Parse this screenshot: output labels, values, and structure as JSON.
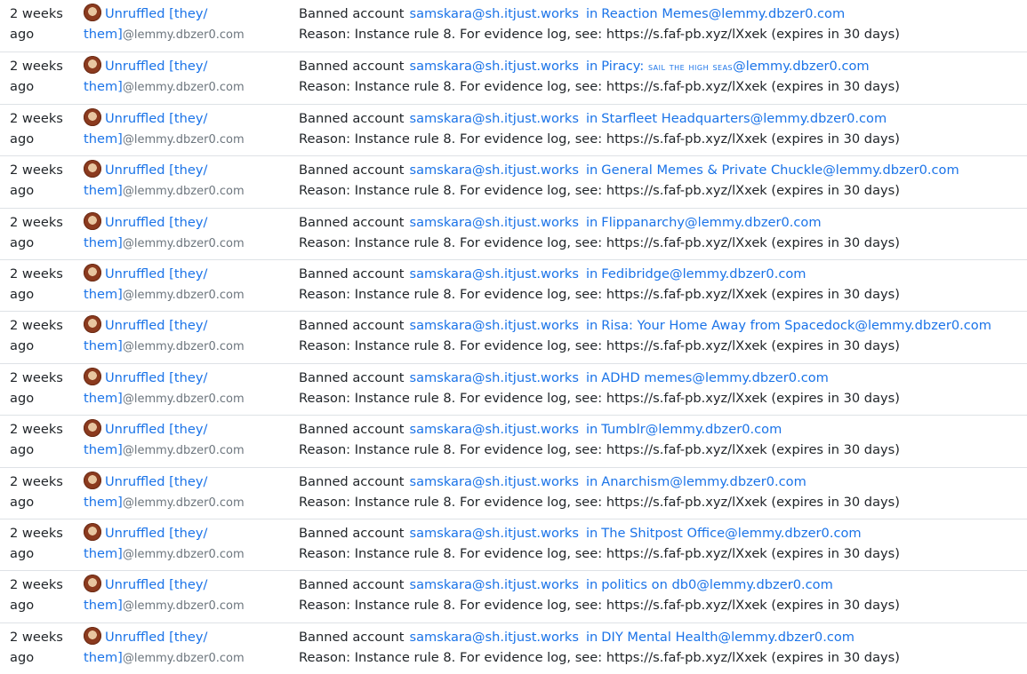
{
  "common": {
    "time_line1": "2 weeks",
    "time_line2": "ago",
    "mod_name_part1": "Unruffled [they/",
    "mod_name_part2": "them]",
    "mod_instance": "@lemmy.dbzer0.com",
    "action_prefix": "Banned account",
    "banned_user": "samskara@sh.itjust.works",
    "in_word": "in",
    "reason": "Reason: Instance rule 8. For evidence log, see: https://s.faf-pb.xyz/lXxek (expires in 30 days)"
  },
  "entries": [
    {
      "community": "Reaction Memes@lemmy.dbzer0.com"
    },
    {
      "community_prefix": "Piracy: ",
      "community_smallcaps": "sail the high seas",
      "community_suffix": "@lemmy.dbzer0.com"
    },
    {
      "community": "Starfleet Headquarters@lemmy.dbzer0.com"
    },
    {
      "community": "General Memes & Private Chuckle@lemmy.dbzer0.com"
    },
    {
      "community": "Flippanarchy@lemmy.dbzer0.com"
    },
    {
      "community": "Fedibridge@lemmy.dbzer0.com"
    },
    {
      "community": "Risa: Your Home Away from Spacedock@lemmy.dbzer0.com"
    },
    {
      "community": "ADHD memes@lemmy.dbzer0.com"
    },
    {
      "community": "Tumblr@lemmy.dbzer0.com"
    },
    {
      "community": "Anarchism@lemmy.dbzer0.com"
    },
    {
      "community": "The Shitpost Office@lemmy.dbzer0.com"
    },
    {
      "community": "politics on db0@lemmy.dbzer0.com"
    },
    {
      "community": "DIY Mental Health@lemmy.dbzer0.com"
    }
  ],
  "colors": {
    "link": "#1a73e8",
    "text": "#212529",
    "muted": "#6c757d",
    "divider": "#dee2e6"
  },
  "icons": {
    "avatar": "mod-avatar"
  }
}
